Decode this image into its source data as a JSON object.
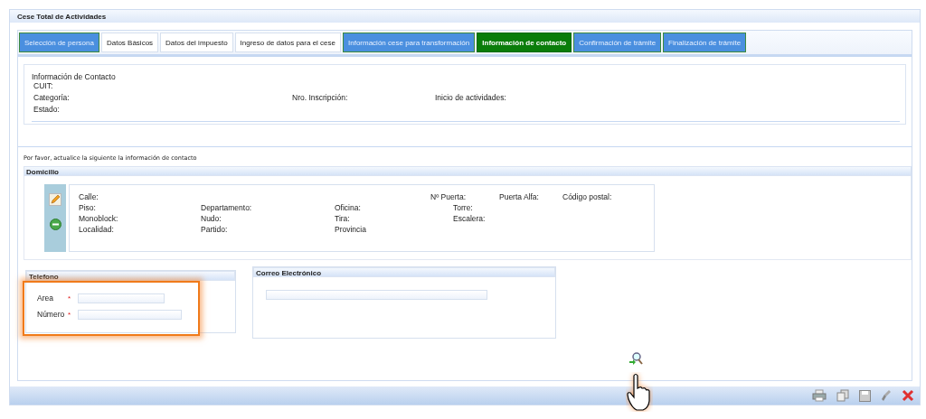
{
  "window": {
    "title": "Cese Total de Actividades"
  },
  "tabs": [
    {
      "label": "Selección de persona",
      "selected": false,
      "kind": "visited"
    },
    {
      "label": "Datos Básicos",
      "selected": false,
      "kind": "plain"
    },
    {
      "label": "Datos del impuesto",
      "selected": false,
      "kind": "plain"
    },
    {
      "label": "Ingreso de datos para el cese",
      "selected": false,
      "kind": "plain"
    },
    {
      "label": "Información cese para transformación",
      "selected": false,
      "kind": "visited"
    },
    {
      "label": "Información de contacto",
      "selected": true,
      "kind": "visited"
    },
    {
      "label": "Confirmación de trámite",
      "selected": false,
      "kind": "visited"
    },
    {
      "label": "Finalización de trámite",
      "selected": false,
      "kind": "visited"
    }
  ],
  "contact_info": {
    "heading": "Información de Contacto",
    "cuit": "CUIT:",
    "rows": [
      [
        "Categoría:",
        "Nro. Inscripción:",
        "Inicio de actividades:"
      ],
      [
        "Estado:"
      ]
    ]
  },
  "instruction": "Por favor, actualice la siguiente la información de contacto",
  "domicilio": {
    "title": "Domicilio",
    "first_row": [
      "Calle:",
      "Nº Puerta:",
      "Puerta Alfa:",
      "Código postal:"
    ],
    "rows": [
      [
        "Piso:",
        "Departamento:",
        "Oficina:",
        "Torre:"
      ],
      [
        "Monoblock:",
        "Nudo:",
        "Tira:",
        "Escalera:"
      ],
      [
        "Localidad:",
        "Partido:",
        "Provincia"
      ]
    ]
  },
  "telefono": {
    "title": "Telefono",
    "fields": [
      {
        "label": "Area",
        "required_mark": "*"
      },
      {
        "label": "Número",
        "required_mark": "*"
      }
    ],
    "highlighted": true
  },
  "correo": {
    "title": "Correo Electrónico"
  }
}
